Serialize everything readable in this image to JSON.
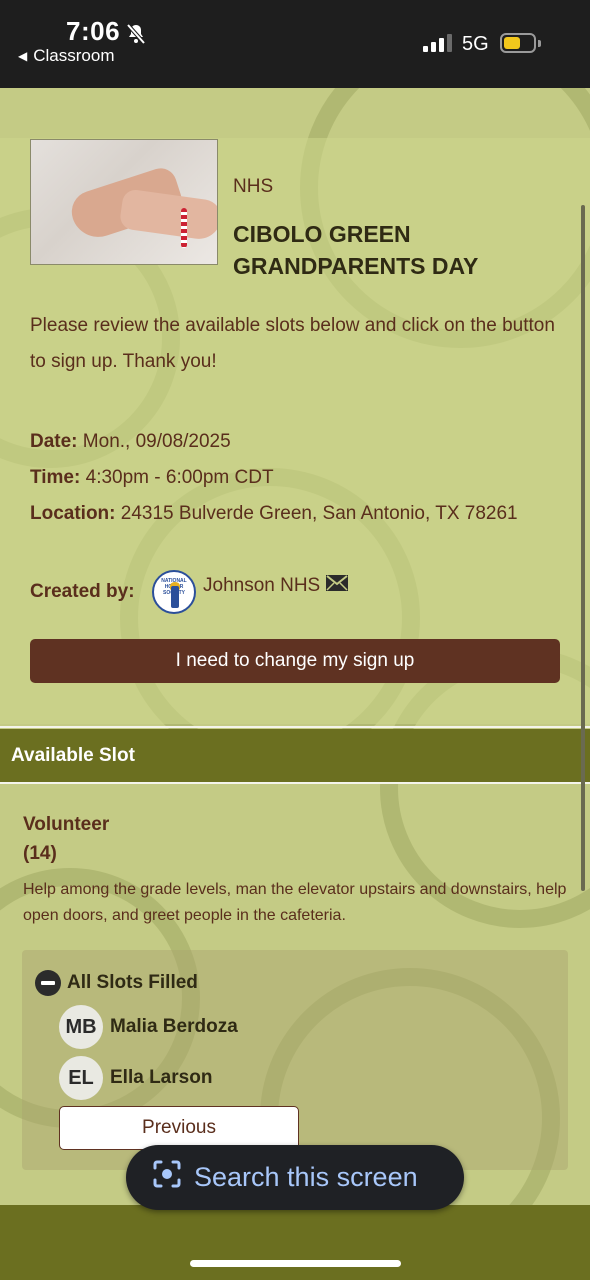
{
  "status_bar": {
    "time": "7:06",
    "back_label": "Classroom",
    "network": "5G"
  },
  "event": {
    "org": "NHS",
    "title": "CIBOLO GREEN GRANDPARENTS DAY",
    "intro": "Please review the available slots below and click on the button to sign up. Thank you!",
    "date_label": "Date:",
    "date_value": "Mon., 09/08/2025",
    "time_label": "Time:",
    "time_value": "4:30pm - 6:00pm CDT",
    "location_label": "Location:",
    "location_value": "24315 Bulverde Green, San Antonio, TX 78261",
    "created_by_label": "Created by:",
    "creator_name": "Johnson NHS",
    "creator_logo_text": "NATIONAL HONOR SOCIETY",
    "change_button": "I need to change my sign up"
  },
  "section": {
    "header": "Available Slot"
  },
  "slot": {
    "title": "Volunteer",
    "count": "(14)",
    "description": "Help among the grade levels, man the elevator upstairs and downstairs, help open doors, and greet people in the cafeteria.",
    "filled_label": "All Slots Filled",
    "people": [
      {
        "initials": "MB",
        "name": "Malia Berdoza"
      },
      {
        "initials": "EL",
        "name": "Ella Larson"
      }
    ],
    "previous_button": "Previous"
  },
  "overlay": {
    "search_label": "Search this screen"
  },
  "colors": {
    "brown": "#5f3222",
    "olive": "#6b6f20",
    "background": "#c4cb85"
  }
}
